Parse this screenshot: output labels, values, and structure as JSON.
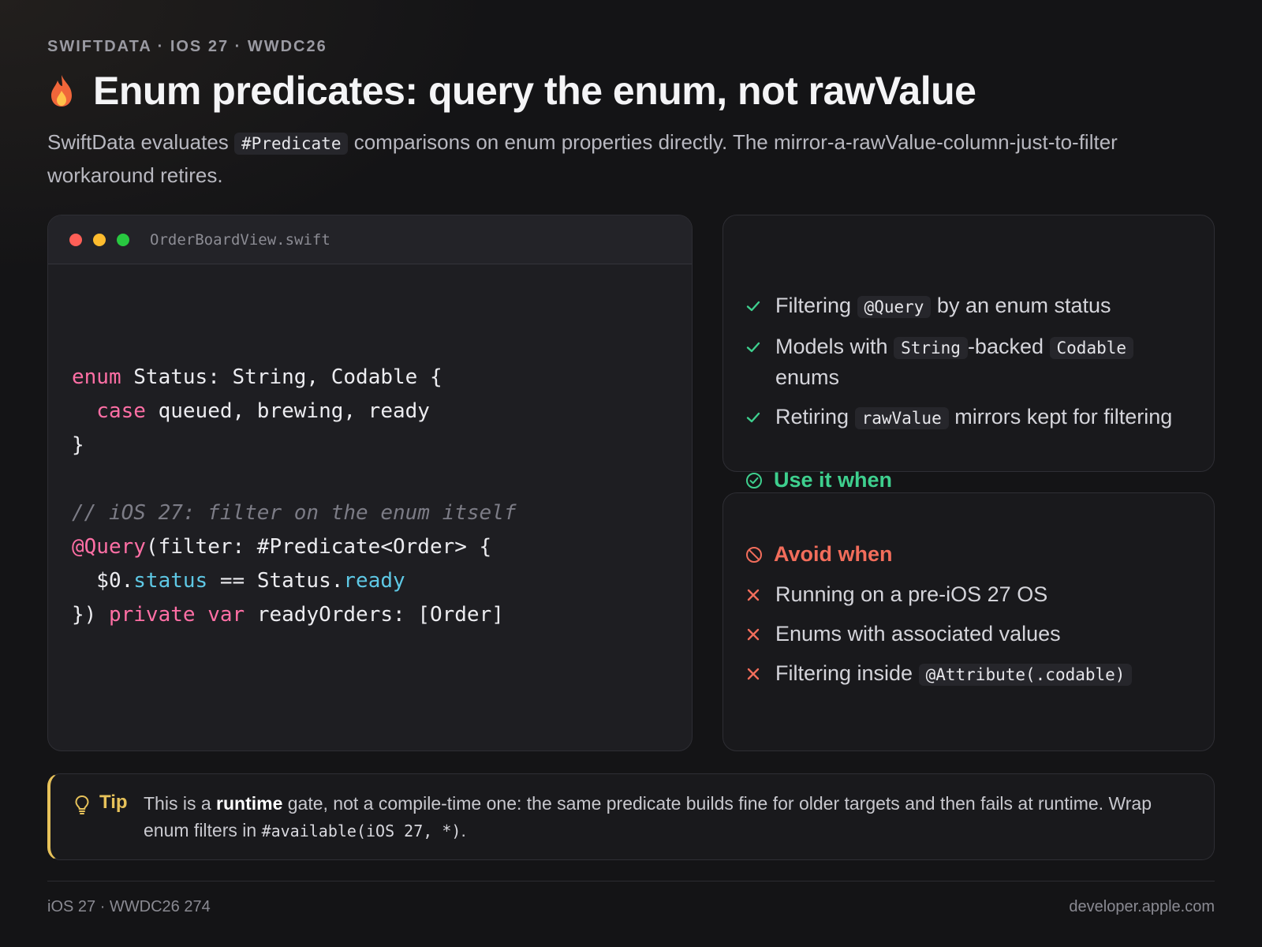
{
  "header": {
    "kicker": "SWIFTDATA · IOS 27 · WWDC26",
    "title": "Enum predicates: query the enum, not rawValue",
    "subtitle_pre": "SwiftData evaluates",
    "subtitle_code": "#Predicate",
    "subtitle_post": "comparisons on enum properties directly. The mirror-a-rawValue-column-just-to-filter workaround retires.",
    "title_icon": "flame-icon"
  },
  "code_window": {
    "filename": "OrderBoardView.swift",
    "lines": {
      "l1_kw": "enum",
      "l1_rest": " Status: String, Codable {",
      "l2_kw": "  case",
      "l2_rest": " queued, brewing, ready",
      "l3": "}",
      "l5_comment": "// iOS 27: filter on the enum itself",
      "l6_attr": "@Query",
      "l6_rest": "(filter: #Predicate<Order> {",
      "l7_pre": "  $0.",
      "l7_prop": "status",
      "l7_mid": " == Status.",
      "l7_val": "ready",
      "l8_pre": "}) ",
      "l8_kw1": "private",
      "l8_sp": " ",
      "l8_kw2": "var",
      "l8_rest": " readyOrders: [Order]"
    }
  },
  "use_card": {
    "heading": "Use it when",
    "items": [
      {
        "pre": "Filtering",
        "code": "@Query",
        "post": "by an enum status"
      },
      {
        "pre": "Models with",
        "code": "String",
        "mid": "-backed",
        "code2": "Codable",
        "post": "enums"
      },
      {
        "pre": "Retiring",
        "code": "rawValue",
        "post": "mirrors kept for filtering"
      }
    ],
    "accent": "#3ecf8e"
  },
  "avoid_card": {
    "heading": "Avoid when",
    "items": [
      {
        "text": "Running on a pre-iOS 27 OS"
      },
      {
        "text": "Enums with associated values"
      },
      {
        "pre": "Filtering inside",
        "code": "@Attribute(.codable)"
      }
    ],
    "accent": "#f26d5b"
  },
  "tip": {
    "label": "Tip",
    "pre": "This is a",
    "bold": "runtime",
    "post": "gate, not a compile-time one: the same predicate builds fine for older targets and then fails at runtime. Wrap enum filters in",
    "code": "#available(iOS 27, *)",
    "end": ".",
    "accent": "#e7c25a"
  },
  "footer": {
    "left": "iOS 27 · WWDC26 274",
    "right": "developer.apple.com"
  }
}
